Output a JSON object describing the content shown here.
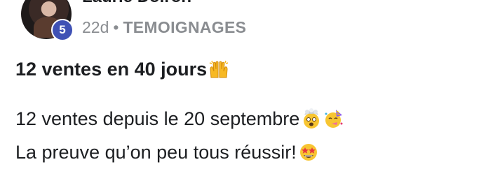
{
  "post": {
    "author": "Laurie Doiron",
    "level": "5",
    "age": "22d",
    "separator": "•",
    "category": "TEMOIGNAGES",
    "title": "12 ventes en 40 jours",
    "body_line1": "12 ventes depuis le 20 septembre",
    "body_line2": "La preuve qu’on peu tous réussir!"
  },
  "icons": {
    "title_emoji": "raising-hands-icon",
    "line1_emojis": [
      "exploding-head-icon",
      "partying-face-icon"
    ],
    "line2_emoji": "star-struck-icon"
  },
  "colors": {
    "badge": "#3f51b5",
    "meta_text": "#8a8d91",
    "text": "#1c1e21"
  }
}
